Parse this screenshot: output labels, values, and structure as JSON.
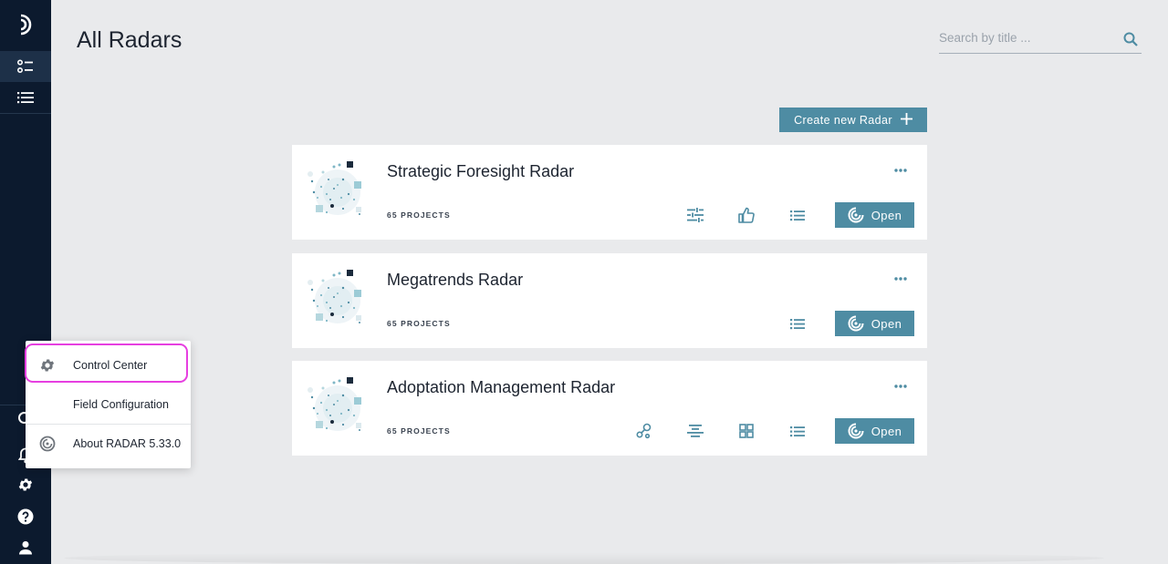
{
  "header": {
    "title": "All Radars",
    "search_placeholder": "Search by title ..."
  },
  "actions": {
    "create_label": "Create new Radar"
  },
  "radars": [
    {
      "title": "Strategic Foresight Radar",
      "count": "65 PROJECTS",
      "tools": [
        "sliders-icon",
        "thumbs-up-icon",
        "list-icon"
      ]
    },
    {
      "title": "Megatrends Radar",
      "count": "65 PROJECTS",
      "tools": [
        "list-icon"
      ]
    },
    {
      "title": "Adoptation Management Radar",
      "count": "65 PROJECTS",
      "tools": [
        "network-icon",
        "align-center-icon",
        "grid-icon",
        "list-icon"
      ]
    }
  ],
  "card_actions": {
    "open_label": "Open"
  },
  "menu": {
    "items": [
      {
        "label": "Control Center",
        "icon": "gear-icon"
      },
      {
        "label": "Field Configuration",
        "icon": ""
      },
      {
        "label": "About RADAR 5.33.0",
        "icon": "radar-icon"
      }
    ]
  },
  "colors": {
    "sidebar": "#0c1a2e",
    "accent": "#4e8ca3",
    "highlight": "#e63fe0",
    "background": "#e9eaec"
  }
}
